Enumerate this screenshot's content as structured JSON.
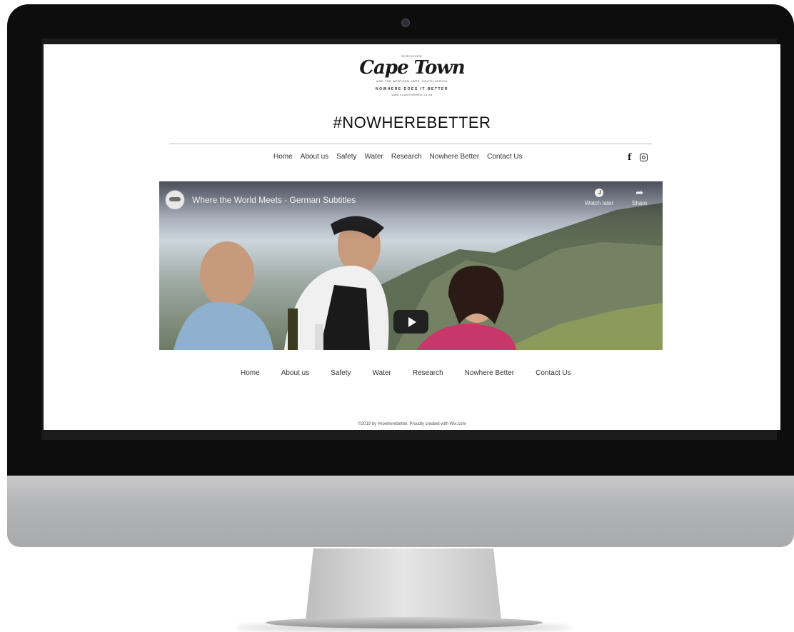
{
  "site": {
    "logo": {
      "discover": "DISCOVER",
      "script": "Cape Town",
      "tagline": "AND THE WESTERN CAPE, SOUTH AFRICA",
      "slogan": "NOWHERE DOES IT BETTER",
      "url": "www.nowherebetter.co.za"
    },
    "hashtag": "#NOWHEREBETTER",
    "top_nav": [
      "Home",
      "About us",
      "Safety",
      "Water",
      "Research",
      "Nowhere Better",
      "Contact Us"
    ],
    "social": {
      "facebook": "f",
      "instagram_icon": "instagram-icon"
    },
    "video": {
      "title": "Where the World Meets - German Subtitles",
      "watch_later": "Watch later",
      "share": "Share"
    },
    "bottom_nav": [
      "Home",
      "About us",
      "Safety",
      "Water",
      "Research",
      "Nowhere Better",
      "Contact Us"
    ],
    "footer": "©2019 by #nowherebetter. Proudly created with Wix.com"
  }
}
